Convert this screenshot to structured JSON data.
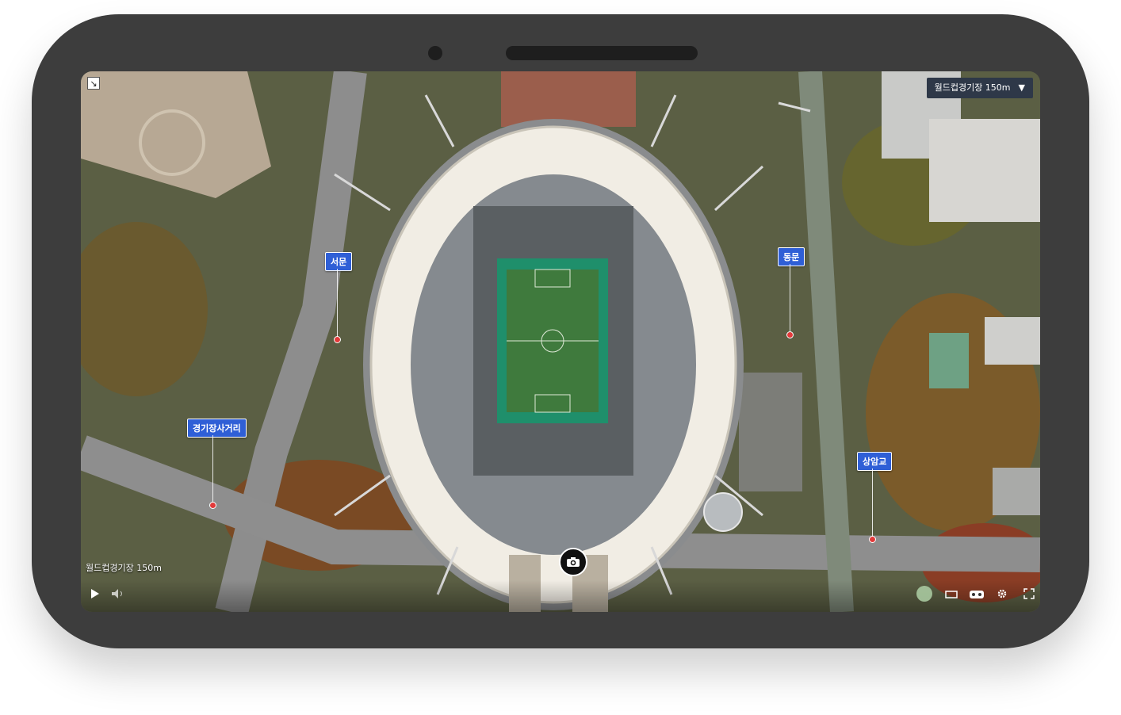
{
  "location_select": {
    "label": "월드컵경기장 150m",
    "arrow": "▼"
  },
  "caption": "월드컵경기장 150m",
  "pins": [
    {
      "label": "서문"
    },
    {
      "label": "동문"
    },
    {
      "label": "경기장사거리"
    },
    {
      "label": "상암교"
    }
  ],
  "controls": {
    "icons": [
      "play-icon",
      "volume-icon",
      "minimap-icon",
      "screen-ratio-icon",
      "vr-icon",
      "settings-icon",
      "fullscreen-icon"
    ]
  },
  "colors": {
    "pin": "#2f5fd6",
    "pin_dot": "#e23a3a",
    "select_bg": "#2e3848",
    "device": "#3d3d3d"
  }
}
